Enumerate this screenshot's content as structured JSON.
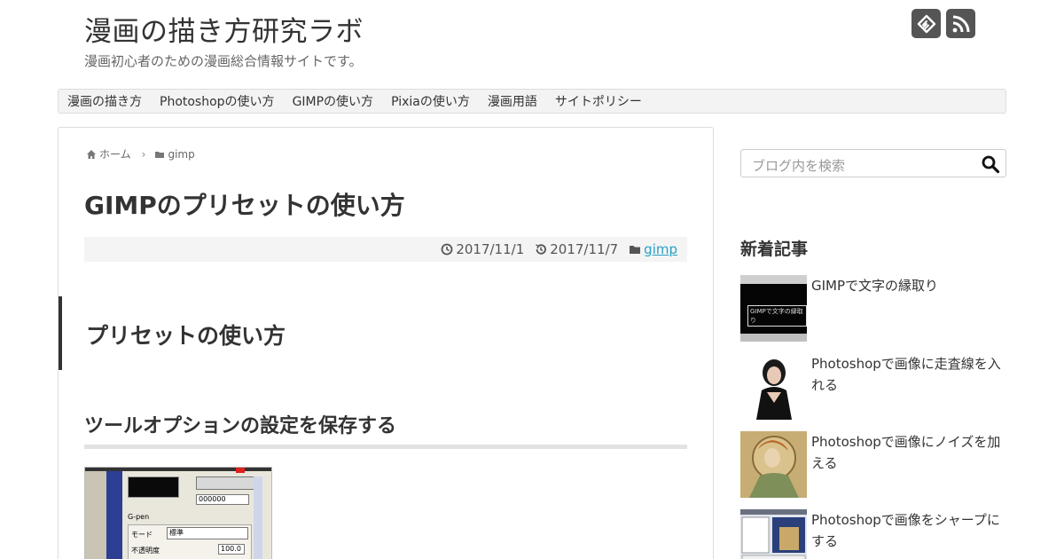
{
  "header": {
    "site_title": "漫画の描き方研究ラボ",
    "site_description": "漫画初心者のための漫画総合情報サイトです。",
    "social_icons": [
      "feedly-icon",
      "rss-icon"
    ]
  },
  "nav": {
    "items": [
      "漫画の描き方",
      "Photoshopの使い方",
      "GIMPの使い方",
      "Pixiaの使い方",
      "漫画用語",
      "サイトポリシー"
    ]
  },
  "breadcrumb": {
    "home": "ホーム",
    "category": "gimp"
  },
  "article": {
    "title": "GIMPのプリセットの使い方",
    "published": "2017/11/1",
    "updated": "2017/11/7",
    "category": "gimp",
    "h2": "プリセットの使い方",
    "h3": "ツールオプションの設定を保存する",
    "screenshot": {
      "field_value": "000000",
      "brush_name": "G-pen",
      "mode_label": "モード",
      "mode_value": "標準",
      "opacity_label": "不透明度",
      "opacity_value": "100.0"
    }
  },
  "sidebar": {
    "search_placeholder": "ブログ内を検索",
    "recent_heading": "新着記事",
    "recent_posts": [
      {
        "title": "GIMPで文字の縁取り",
        "thumb_caption": "GIMPで文字の縁取り"
      },
      {
        "title": "Photoshopで画像に走査線を入れる"
      },
      {
        "title": "Photoshopで画像にノイズを加える"
      },
      {
        "title": "Photoshopで画像をシャープにする"
      }
    ]
  },
  "colors": {
    "link": "#2aa0c5",
    "social_bg": "#555555",
    "meta_bg": "#f4f4f4"
  }
}
